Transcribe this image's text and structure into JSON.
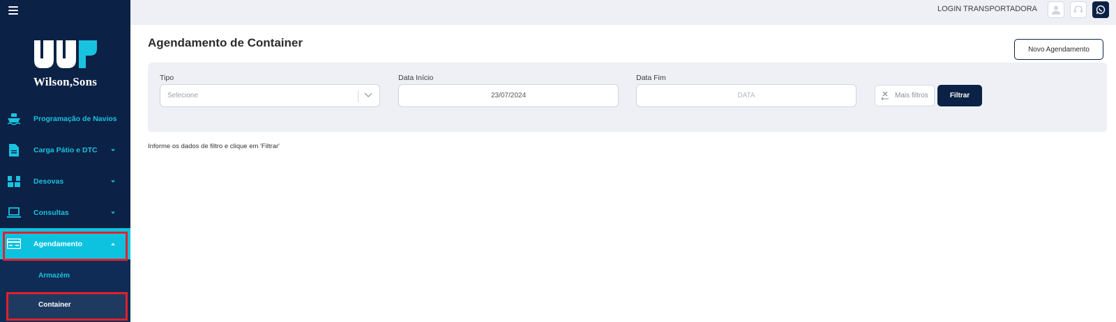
{
  "app": {
    "brand_name": "Wilson,Sons"
  },
  "sidebar": {
    "items": [
      {
        "label": "Programação de Navios",
        "icon": "ship-icon",
        "has_caret": false
      },
      {
        "label": "Carga Pátio e DTC",
        "icon": "document-icon",
        "has_caret": true
      },
      {
        "label": "Desovas",
        "icon": "boxes-icon",
        "has_caret": true
      },
      {
        "label": "Consultas",
        "icon": "laptop-icon",
        "has_caret": true
      },
      {
        "label": "Agendamento",
        "icon": "card-icon",
        "has_caret": true,
        "active": true
      }
    ],
    "subitems": [
      {
        "label": "Armazém"
      },
      {
        "label": "Container",
        "selected": true
      }
    ]
  },
  "topbar": {
    "login_label": "LOGIN TRANSPORTADORA",
    "icons": [
      "user-icon",
      "support-icon",
      "whatsapp-icon"
    ]
  },
  "main": {
    "title": "Agendamento de Container",
    "new_button_label": "Novo Agendamento",
    "filters": {
      "tipo": {
        "label": "Tipo",
        "placeholder": "Selecione"
      },
      "data_inicio": {
        "label": "Data Início",
        "value": "23/07/2024"
      },
      "data_fim": {
        "label": "Data Fim",
        "placeholder": "DATA"
      },
      "more_filters_label": "Mais filtros",
      "filter_button_label": "Filtrar"
    },
    "hint": "Informe os dados de filtro e clique em 'Filtrar'"
  },
  "colors": {
    "sidebar_bg": "#0b2145",
    "accent": "#0cc2df",
    "highlight_border": "#e3202a",
    "panel_bg": "#eef0f5"
  }
}
